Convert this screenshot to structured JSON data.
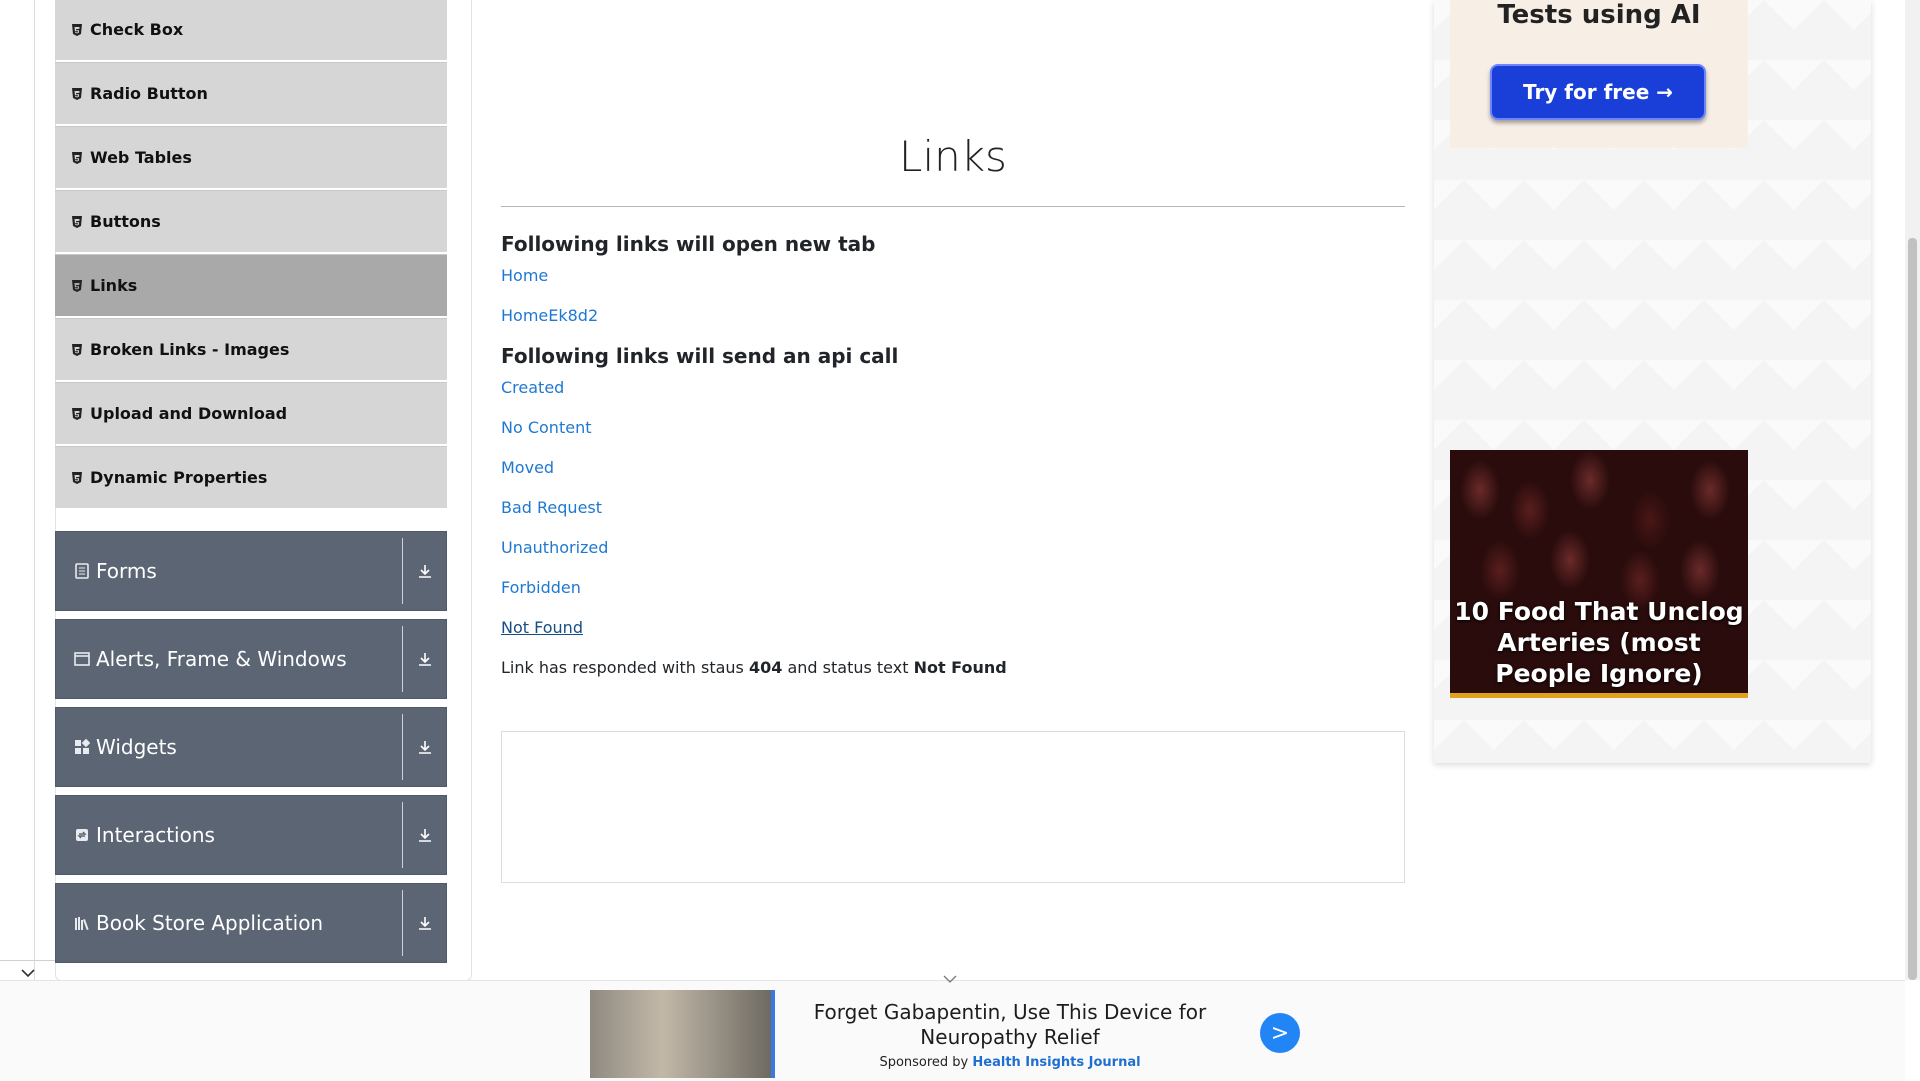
{
  "sidebar": {
    "sub_items": [
      {
        "label": "Check Box",
        "active": false
      },
      {
        "label": "Radio Button",
        "active": false
      },
      {
        "label": "Web Tables",
        "active": false
      },
      {
        "label": "Buttons",
        "active": false
      },
      {
        "label": "Links",
        "active": true
      },
      {
        "label": "Broken Links - Images",
        "active": false
      },
      {
        "label": "Upload and Download",
        "active": false
      },
      {
        "label": "Dynamic Properties",
        "active": false
      }
    ],
    "groups": [
      {
        "label": "Forms",
        "icon": "form-icon"
      },
      {
        "label": "Alerts, Frame & Windows",
        "icon": "window-icon"
      },
      {
        "label": "Widgets",
        "icon": "widgets-icon"
      },
      {
        "label": "Interactions",
        "icon": "interactions-icon"
      },
      {
        "label": "Book Store Application",
        "icon": "book-icon"
      }
    ]
  },
  "main": {
    "title": "Links",
    "section1_heading": "Following links will open new tab",
    "new_tab_links": [
      "Home",
      "HomeEk8d2"
    ],
    "section2_heading": "Following links will send an api call",
    "api_links": [
      "Created",
      "No Content",
      "Moved",
      "Bad Request",
      "Unauthorized",
      "Forbidden",
      "Not Found"
    ],
    "response": {
      "prefix": "Link has responded with staus ",
      "status_code": "404",
      "middle": " and status text ",
      "status_text": "Not Found"
    }
  },
  "right_ads": {
    "promo_text": "Tests using AI",
    "promo_button": "Try for free →",
    "food_ad_text": "10 Food That Unclog Arteries (most People Ignore)"
  },
  "bottom_ad": {
    "title": "Forget Gabapentin, Use This Device for Neuropathy Relief",
    "sponsor_prefix": "Sponsored by ",
    "sponsor_name": "Health Insights Journal",
    "go_label": ">"
  },
  "colors": {
    "link": "#1f78d1",
    "group_bg": "#5b6573",
    "sub_item_bg": "#d6d6d6",
    "active_sub_item_bg": "#a9a9a9",
    "cta_blue": "#1a3fd8"
  }
}
